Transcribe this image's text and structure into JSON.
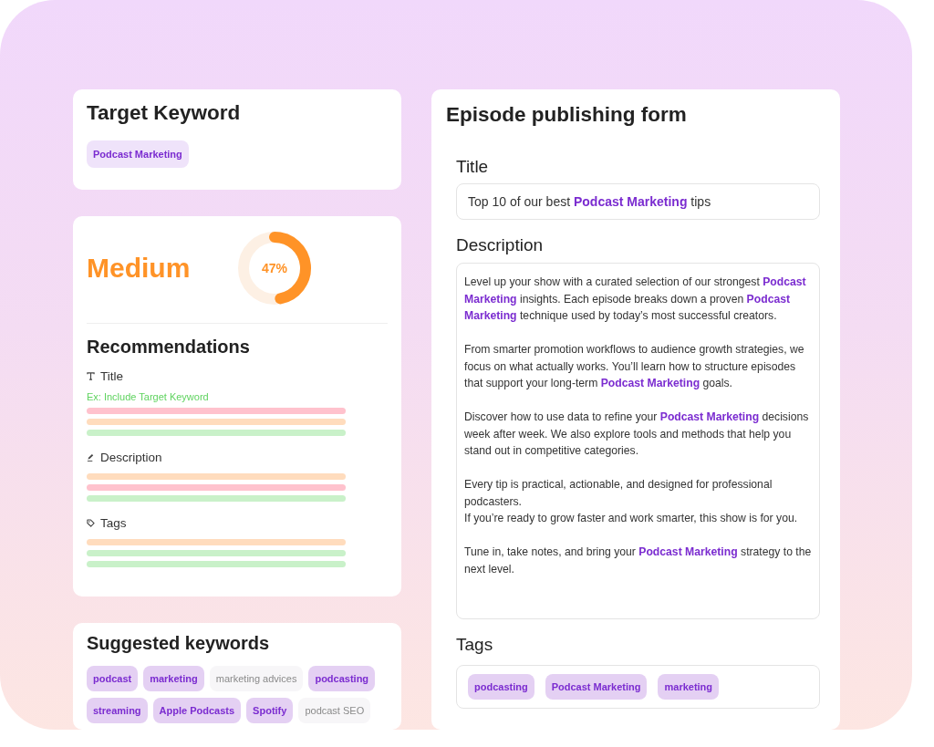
{
  "target_keyword": {
    "title": "Target Keyword",
    "keyword": "Podcast Marketing"
  },
  "score": {
    "label": "Medium",
    "percent": "47%",
    "level": 0.47
  },
  "recommendations": {
    "title": "Recommendations",
    "items": [
      {
        "kind": "title",
        "label": "Title",
        "hint": "Ex: Include Target Keyword",
        "bars": [
          {
            "color": "#ffc2cd"
          },
          {
            "color": "#ffdcbd"
          },
          {
            "color": "#c9f1c9"
          }
        ]
      },
      {
        "kind": "description",
        "label": "Description",
        "bars": [
          {
            "color": "#ffdcbd"
          },
          {
            "color": "#ffc2cd"
          },
          {
            "color": "#c9f1c9"
          }
        ]
      },
      {
        "kind": "tags",
        "label": "Tags",
        "bars": [
          {
            "color": "#ffdcbd"
          },
          {
            "color": "#c9f1c9"
          },
          {
            "color": "#c9f1c9"
          }
        ]
      }
    ]
  },
  "suggested_keywords": {
    "title": "Suggested keywords",
    "keywords": [
      {
        "label": "podcast",
        "selected": true
      },
      {
        "label": "marketing",
        "selected": true
      },
      {
        "label": "marketing advices",
        "selected": false
      },
      {
        "label": "podcasting",
        "selected": true
      },
      {
        "label": "streaming",
        "selected": true
      },
      {
        "label": "Apple Podcasts",
        "selected": true
      },
      {
        "label": "Spotify",
        "selected": true
      },
      {
        "label": "podcast SEO",
        "selected": false
      }
    ]
  },
  "form": {
    "title": "Episode publishing form",
    "fields": [
      {
        "kind": "text",
        "label": "Title",
        "value": "Top 10 of our best **Podcast Marketing** tips"
      },
      {
        "kind": "textarea",
        "label": "Description",
        "paragraphs": [
          {
            "lines": [
              "Level up your show with a curated selection of our strongest **Podcast Marketing** insights. Each episode breaks down a proven **Podcast Marketing** technique used by today’s most successful creators."
            ]
          },
          {
            "lines": [
              "From smarter promotion workflows to audience growth strategies, we focus on what actually works. You’ll learn how to structure episodes that support your long-term **Podcast Marketing** goals."
            ]
          },
          {
            "lines": [
              "Discover how to use data to refine your **Podcast Marketing** decisions week after week. We also explore tools and methods that help you stand out in competitive categories."
            ]
          },
          {
            "lines": [
              "Every tip is practical, actionable, and designed for professional podcasters.",
              "If you’re ready to grow faster and work smarter, this show is for you."
            ]
          },
          {
            "lines": [
              "Tune in, take notes, and bring your **Podcast Marketing** strategy to the next level."
            ]
          }
        ]
      },
      {
        "kind": "tags",
        "label": "Tags",
        "tags": [
          "podcasting",
          "Podcast Marketing",
          "marketing"
        ]
      }
    ]
  }
}
